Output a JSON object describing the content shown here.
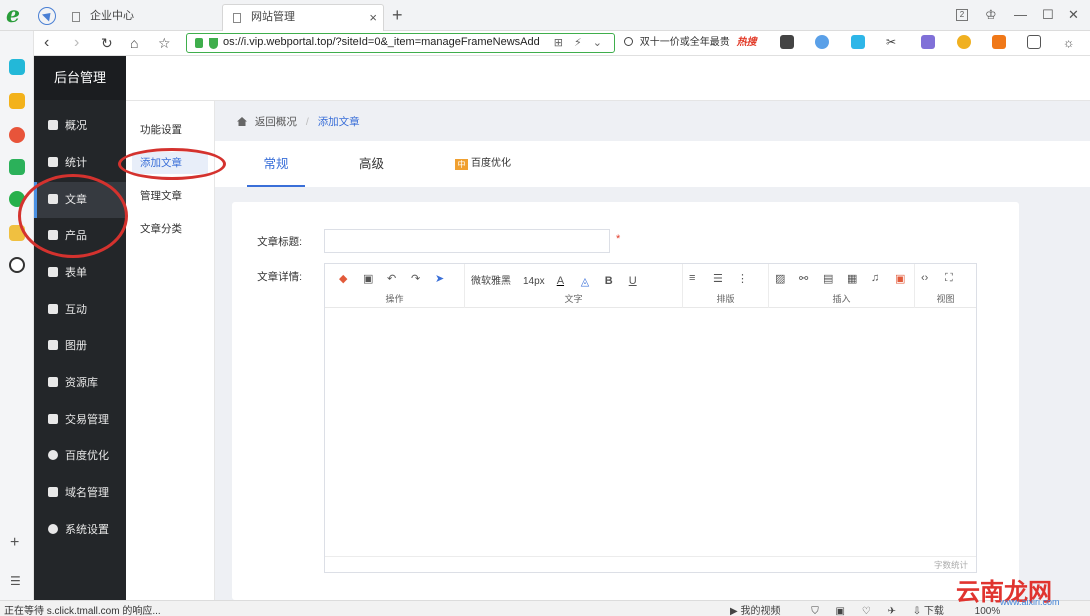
{
  "browser": {
    "tabs": [
      {
        "title": "企业中心",
        "active": false
      },
      {
        "title": "网站管理",
        "active": true
      }
    ],
    "tab_close": "×",
    "tab_add": "+",
    "tab_count": "2",
    "url": "os://i.vip.webportal.top/?siteId=0&_item=manageFrameNewsAdd",
    "search_text": "双十一价或全年最贵",
    "search_hot": "热搜",
    "status_text": "正在等待 s.click.tmall.com 的响应...",
    "status_video": "我的视频",
    "status_download": "下载",
    "status_zoom": "100%"
  },
  "app": {
    "brand": "后台管理",
    "sidebar": [
      {
        "label": "概况",
        "icon": "home-icon"
      },
      {
        "label": "统计",
        "icon": "chart-icon"
      },
      {
        "label": "文章",
        "icon": "article-icon",
        "active": true
      },
      {
        "label": "产品",
        "icon": "grid-icon"
      },
      {
        "label": "表单",
        "icon": "form-icon"
      },
      {
        "label": "互动",
        "icon": "chat-icon"
      },
      {
        "label": "图册",
        "icon": "album-icon"
      },
      {
        "label": "资源库",
        "icon": "database-icon"
      },
      {
        "label": "交易管理",
        "icon": "trade-icon"
      },
      {
        "label": "百度优化",
        "icon": "baidu-icon"
      },
      {
        "label": "域名管理",
        "icon": "domain-icon"
      },
      {
        "label": "系统设置",
        "icon": "gear-icon"
      }
    ],
    "submenu": [
      {
        "label": "功能设置"
      },
      {
        "label": "添加文章",
        "active": true
      },
      {
        "label": "管理文章"
      },
      {
        "label": "文章分类"
      }
    ],
    "breadcrumb": {
      "back": "返回概况",
      "current": "添加文章"
    },
    "tabs": [
      {
        "label": "常规",
        "active": true
      },
      {
        "label": "高级"
      },
      {
        "label": "百度优化"
      }
    ],
    "baidu_badge": "中",
    "form": {
      "title_label": "文章标题:",
      "title_value": "",
      "required_mark": "*",
      "detail_label": "文章详情:"
    },
    "editor": {
      "groups": [
        "操作",
        "文字",
        "排版",
        "插入",
        "视图"
      ],
      "font_family": "微软雅黑",
      "font_size": "14px",
      "word_count_label": "字数统计"
    }
  },
  "watermark": {
    "text": "云南龙网",
    "url": "www.aixiri.com"
  },
  "colors": {
    "accent": "#3a6fd8",
    "sidebar_bg": "#232629",
    "annotation": "#d4322e"
  }
}
